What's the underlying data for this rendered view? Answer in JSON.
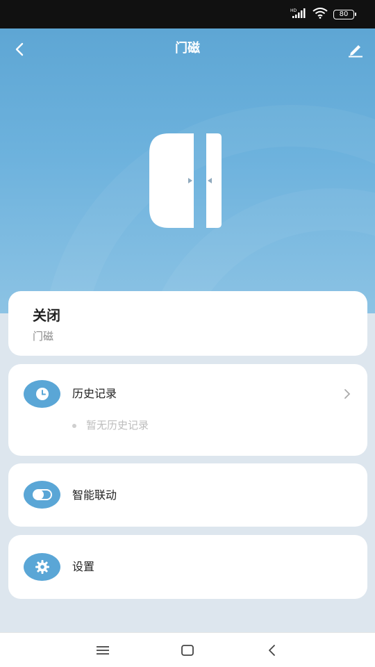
{
  "status_bar": {
    "network": "HD",
    "battery": "80"
  },
  "header": {
    "title": "门磁",
    "back_icon": "back-arrow-icon",
    "edit_icon": "edit-pencil-icon"
  },
  "device": {
    "image": "door-sensor-icon"
  },
  "status_card": {
    "state": "关闭",
    "device_name": "门磁"
  },
  "history": {
    "label": "历史记录",
    "icon": "clock-icon",
    "empty_text": "暂无历史记录"
  },
  "linkage": {
    "label": "智能联动",
    "icon": "toggle-icon"
  },
  "settings": {
    "label": "设置",
    "icon": "gear-icon"
  },
  "colors": {
    "accent": "#5aa6d6",
    "hero_top": "#5ea6d4",
    "hero_bottom": "#8cc3e4",
    "page_bg": "#dde6ee"
  }
}
